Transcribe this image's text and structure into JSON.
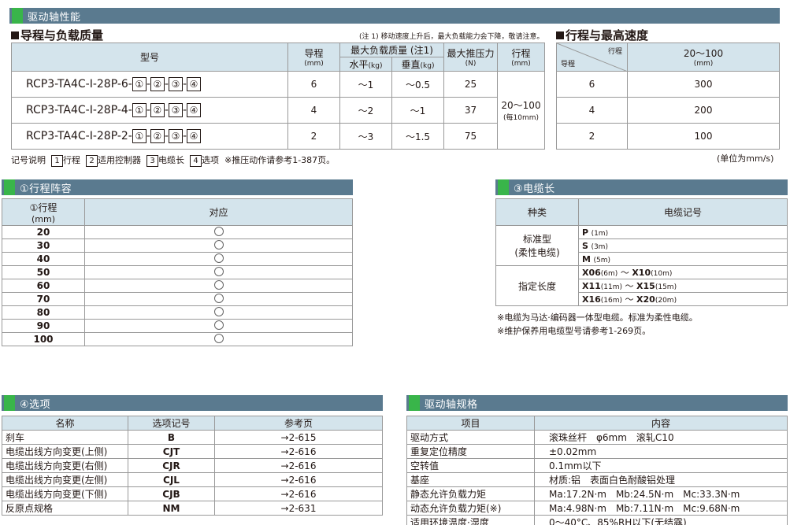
{
  "banner_main": "驱动轴性能",
  "lead": {
    "title": "导程与负载质量",
    "note": "(注 1) 移动速度上升后，最大负载能力会下降，敬请注意。",
    "h_model": "型号",
    "h_lead": "导程",
    "h_lead_unit": "(mm)",
    "h_load": "最大负载质量 (注1)",
    "h_horiz": "水平",
    "h_horiz_unit": "(kg)",
    "h_vert": "垂直",
    "h_vert_unit": "(kg)",
    "h_push": "最大推压力",
    "h_push_unit": "(N)",
    "h_stroke": "行程",
    "h_stroke_unit": "(mm)",
    "stroke": "20～100",
    "stroke_sub": "(每10mm)",
    "rows": [
      {
        "model": "RCP3-TA4C-I-28P-6-",
        "lead": "6",
        "horiz": "～1",
        "vert": "～0.5",
        "push": "25"
      },
      {
        "model": "RCP3-TA4C-I-28P-4-",
        "lead": "4",
        "horiz": "～2",
        "vert": "～1",
        "push": "37"
      },
      {
        "model": "RCP3-TA4C-I-28P-2-",
        "lead": "2",
        "horiz": "～3",
        "vert": "～1.5",
        "push": "75"
      }
    ],
    "b1": "①",
    "b2": "②",
    "b3": "③",
    "b4": "④",
    "dash": "-"
  },
  "legend": {
    "label": "记号说明",
    "i1": "1",
    "t1": "行程",
    "i2": "2",
    "t2": "适用控制器",
    "i3": "3",
    "t3": "电缆长",
    "i4": "4",
    "t4": "选项",
    "tail": "※推压动作请参考1-387页。"
  },
  "speed": {
    "title": "行程与最高速度",
    "h_stroke": "行程",
    "h_lead": "导程",
    "h_range": "20～100",
    "h_range_unit": "(mm)",
    "rows": [
      {
        "lead": "6",
        "v": "300"
      },
      {
        "lead": "4",
        "v": "200"
      },
      {
        "lead": "2",
        "v": "100"
      }
    ],
    "unit": "(单位为mm/s)"
  },
  "stroke_tbl": {
    "banner": "①行程阵容",
    "h1": "①行程",
    "h1u": "(mm)",
    "h2": "对应",
    "rows": [
      "20",
      "30",
      "40",
      "50",
      "60",
      "70",
      "80",
      "90",
      "100"
    ]
  },
  "cable": {
    "banner": "③电缆长",
    "h1": "种类",
    "h2": "电缆记号",
    "std": "标准型",
    "std_sub": "(柔性电缆)",
    "spec": "指定长度",
    "p": "P",
    "p_l": "(1m)",
    "s": "S",
    "s_l": "(3m)",
    "m": "M",
    "m_l": "(5m)",
    "x1a": "X06",
    "x1al": "(6m)",
    "x1b": "X10",
    "x1bl": "(10m)",
    "x2a": "X11",
    "x2al": "(11m)",
    "x2b": "X15",
    "x2bl": "(15m)",
    "x3a": "X16",
    "x3al": "(16m)",
    "x3b": "X20",
    "x3bl": "(20m)",
    "tilde": "～",
    "note1": "※电缆为马达·编码器一体型电缆。标准为柔性电缆。",
    "note2": "※维护保养用电缆型号请参考1-269页。"
  },
  "options": {
    "banner": "④选项",
    "h1": "名称",
    "h2": "选项记号",
    "h3": "参考页",
    "rows": [
      {
        "name": "刹车",
        "code": "B",
        "page": "→2-615"
      },
      {
        "name": "电缆出线方向变更(上侧)",
        "code": "CJT",
        "page": "→2-616"
      },
      {
        "name": "电缆出线方向变更(右侧)",
        "code": "CJR",
        "page": "→2-616"
      },
      {
        "name": "电缆出线方向变更(左侧)",
        "code": "CJL",
        "page": "→2-616"
      },
      {
        "name": "电缆出线方向变更(下侧)",
        "code": "CJB",
        "page": "→2-616"
      },
      {
        "name": "反原点规格",
        "code": "NM",
        "page": "→2-631"
      }
    ]
  },
  "spec": {
    "banner": "驱动轴规格",
    "h1": "项目",
    "h2": "内容",
    "rows": [
      {
        "k": "驱动方式",
        "v": "滚珠丝杆　φ6mm　滚轧C10"
      },
      {
        "k": "重复定位精度",
        "v": "±0.02mm"
      },
      {
        "k": "空转值",
        "v": "0.1mm以下"
      },
      {
        "k": "基座",
        "v": "材质:铝　表面白色耐酸铝处理"
      },
      {
        "k": "静态允许负载力矩",
        "v": "Ma:17.2N·m　Mb:24.5N·m　Mc:33.3N·m"
      },
      {
        "k": "动态允许负载力矩(※)",
        "v": "Ma:4.98N·m　Mb:7.11N·m　Mc:9.68N·m"
      },
      {
        "k": "适用环境温度·湿度",
        "v": "0～40°C、85%RH以下(无结露)"
      }
    ]
  }
}
